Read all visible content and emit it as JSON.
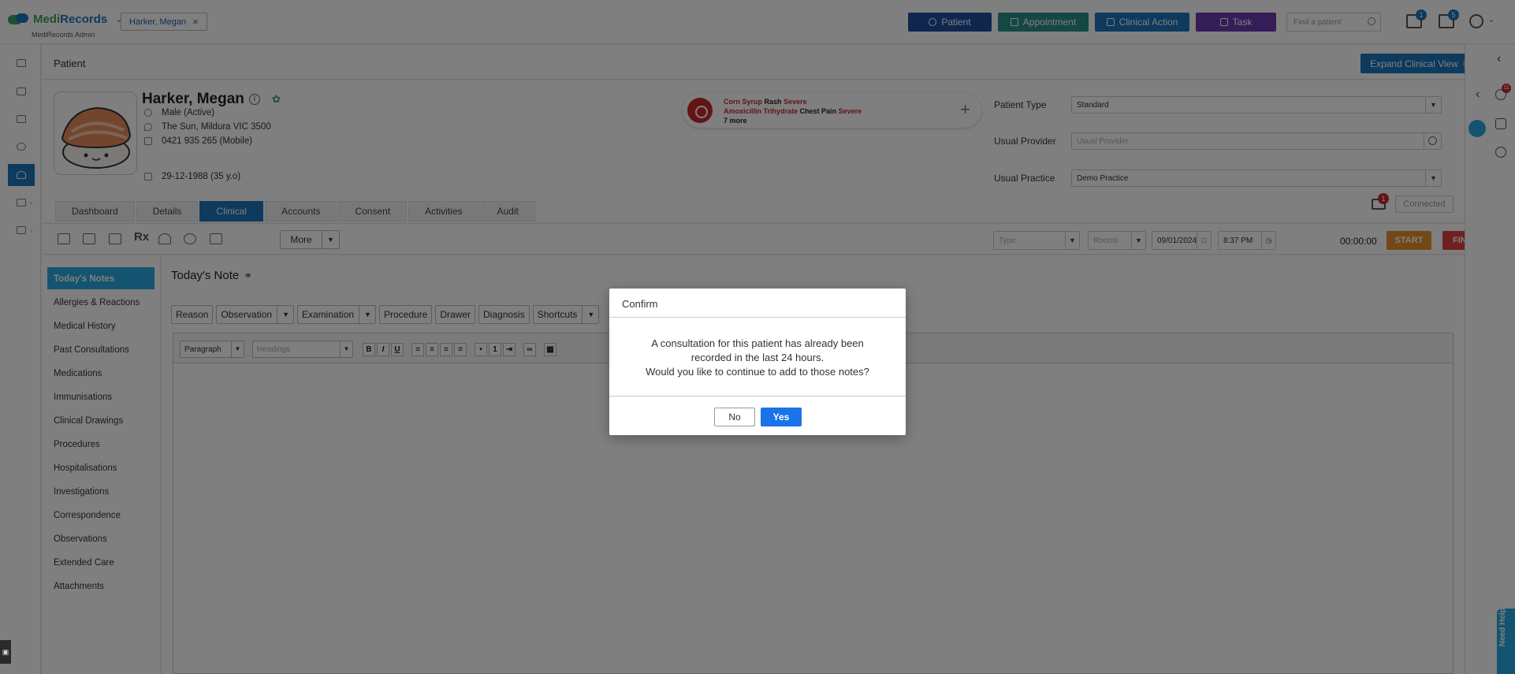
{
  "header": {
    "logo_name_a": "Medi",
    "logo_name_b": "Records",
    "logo_sub": "MediRecords Admin",
    "patient_tab": "Harker, Megan",
    "buttons": {
      "patient": "Patient",
      "appointment": "Appointment",
      "clinical_action": "Clinical Action",
      "task": "Task"
    },
    "search_placeholder": "Find a patient",
    "mail_badge": "1",
    "tasks_badge": "5",
    "colors": {
      "patient": "#1f4e9e",
      "appointment": "#2a8f8a",
      "clinical_action": "#1b75bb",
      "task": "#6a3bb0"
    }
  },
  "page": {
    "title": "Patient",
    "expand_label": "Expand Clinical View"
  },
  "patient": {
    "name": "Harker, Megan",
    "dob": "29-12-1988 (35 y.o)",
    "gender": "Male (Active)",
    "address": "The Sun, Mildura VIC 3500",
    "phone": "0421 935 265 (Mobile)"
  },
  "allergies": {
    "line1": {
      "substance": "Corn Syrup",
      "reaction": "Rash",
      "severity": "Severe"
    },
    "line2": {
      "substance": "Amoxicillin Trihydrate",
      "reaction": "Chest Pain",
      "severity": "Severe"
    },
    "more": "7 more"
  },
  "fields": {
    "patient_type": {
      "label": "Patient Type",
      "value": "Standard"
    },
    "usual_provider": {
      "label": "Usual Provider",
      "placeholder": "Usual Provider"
    },
    "usual_practice": {
      "label": "Usual Practice",
      "value": "Demo Practice"
    }
  },
  "tabs": [
    "Dashboard",
    "Details",
    "Clinical",
    "Accounts",
    "Consent",
    "Activities",
    "Audit"
  ],
  "active_tab": "Clinical",
  "connection": {
    "mail_badge": "1",
    "status": "Connected"
  },
  "toolbar": {
    "more": "More",
    "type_placeholder": "Type",
    "rooms_placeholder": "Rooms",
    "date": "09/01/2024",
    "time": "8:37 PM",
    "timer": "00:00:00",
    "start": "START",
    "finish": "FINISH",
    "rx": "Rx"
  },
  "clinical_nav": [
    "Today's Notes",
    "Allergies & Reactions",
    "Medical History",
    "Past Consultations",
    "Medications",
    "Immunisations",
    "Clinical Drawings",
    "Procedures",
    "Hospitalisations",
    "Investigations",
    "Correspondence",
    "Observations",
    "Extended Care",
    "Attachments"
  ],
  "note": {
    "title": "Today's Note",
    "sections": [
      "Reason",
      "Observation",
      "Examination",
      "Procedure",
      "Drawer",
      "Diagnosis",
      "Shortcuts"
    ],
    "editor": {
      "paragraph": "Paragraph",
      "headings": "Headings",
      "bold": "B",
      "italic": "I",
      "underline": "U"
    }
  },
  "right_rail": {
    "badge": "11"
  },
  "help_label": "Need Help?",
  "modal": {
    "title": "Confirm",
    "line1": "A consultation for this patient has already been",
    "line2": "recorded in the last 24 hours.",
    "line3": "Would you like to continue to add to those notes?",
    "no": "No",
    "yes": "Yes"
  }
}
